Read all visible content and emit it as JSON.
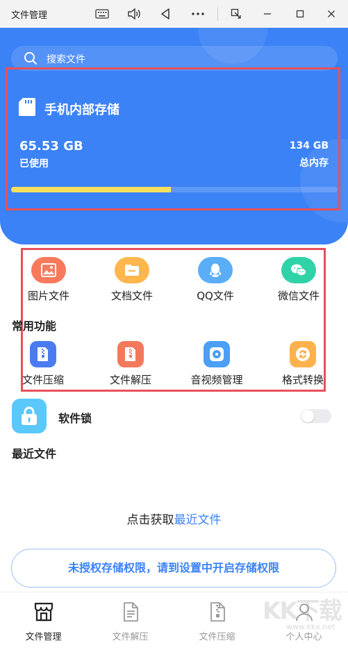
{
  "window": {
    "title": "文件管理",
    "icons": [
      "keyboard-icon",
      "volume-icon",
      "back-icon",
      "more-icon",
      "screen-switch-icon",
      "minimize-icon",
      "maximize-icon",
      "close-icon"
    ]
  },
  "search": {
    "placeholder": "搜索文件"
  },
  "storage": {
    "title": "手机内部存储",
    "used_value": "65.53 GB",
    "used_label": "已使用",
    "total_value": "134 GB",
    "total_label": "总内存",
    "used_fraction": 0.4893
  },
  "categories": [
    {
      "label": "图片文件",
      "icon": "image-icon",
      "color": "#f87a5c"
    },
    {
      "label": "文档文件",
      "icon": "folder-icon",
      "color": "#ffb64d"
    },
    {
      "label": "QQ文件",
      "icon": "qq-icon",
      "color": "#5aaef8"
    },
    {
      "label": "微信文件",
      "icon": "wechat-icon",
      "color": "#2fd3a7"
    }
  ],
  "common": {
    "title": "常用功能",
    "items": [
      {
        "label": "文件压缩",
        "icon": "zip-icon",
        "color": "#4a7bf0"
      },
      {
        "label": "文件解压",
        "icon": "unzip-icon",
        "color": "#f4795c"
      },
      {
        "label": "音视频管理",
        "icon": "media-icon",
        "color": "#4b9ff5"
      },
      {
        "label": "格式转换",
        "icon": "convert-icon",
        "color": "#ffb14d"
      }
    ]
  },
  "software_lock": {
    "label": "软件锁",
    "enabled": false
  },
  "recent": {
    "title": "最近文件",
    "hint_prefix": "点击获取",
    "hint_link": "最近文件"
  },
  "permission_button": "未授权存储权限，请到设置中开启存储权限",
  "bottom_nav": [
    {
      "label": "文件管理",
      "icon": "store-icon",
      "active": true
    },
    {
      "label": "文件解压",
      "icon": "document-icon",
      "active": false
    },
    {
      "label": "文件压缩",
      "icon": "archive-icon",
      "active": false
    },
    {
      "label": "个人中心",
      "icon": "user-icon",
      "active": false
    }
  ],
  "watermark": {
    "text": "KK下载",
    "url_text": "www.kkx.net"
  },
  "colors": {
    "primary": "#3b82f6",
    "progress": "#f6e05e",
    "highlight_box": "#e8505b"
  }
}
